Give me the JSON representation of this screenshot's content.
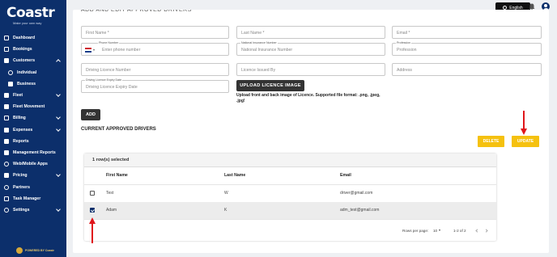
{
  "brand": {
    "name": "Coastr",
    "tagline": "Make your own way"
  },
  "sidebar": {
    "items": [
      {
        "label": "Dashboard"
      },
      {
        "label": "Bookings"
      },
      {
        "label": "Customers"
      },
      {
        "label": "Individual"
      },
      {
        "label": "Business"
      },
      {
        "label": "Fleet"
      },
      {
        "label": "Fleet Movement"
      },
      {
        "label": "Billing"
      },
      {
        "label": "Expenses"
      },
      {
        "label": "Reports"
      },
      {
        "label": "Management Reports"
      },
      {
        "label": "Web/Mobile Apps"
      },
      {
        "label": "Pricing"
      },
      {
        "label": "Partners"
      },
      {
        "label": "Task Manager"
      },
      {
        "label": "Settings"
      }
    ],
    "powered_by": "POWERED BY Coastr"
  },
  "topbar": {
    "language": "English"
  },
  "form": {
    "title": "ADD AND EDIT APPROVED DRIVERS",
    "first_name": {
      "placeholder": "First Name *"
    },
    "last_name": {
      "placeholder": "Last Name *"
    },
    "email": {
      "placeholder": "Email *"
    },
    "phone": {
      "label": "Phone Number",
      "placeholder": "Enter phone number"
    },
    "ni_number": {
      "label": "National Insurance Number",
      "placeholder": "National Insurance Number"
    },
    "profession": {
      "label": "Profession",
      "placeholder": "Profession"
    },
    "licence_number": {
      "placeholder": "Driving Licence Number"
    },
    "licence_issued": {
      "placeholder": "Licence Issued By"
    },
    "address": {
      "placeholder": "Address"
    },
    "expiry": {
      "label": "Driving Licence Expiry Date",
      "placeholder": "Driving Licence Expiry Date"
    },
    "upload_label": "UPLOAD LICENCE IMAGE",
    "upload_note": "Upload front and back image of Licence. Supported file format: .png, .jpeg, .jpg!",
    "add_label": "ADD"
  },
  "drivers": {
    "section_title": "CURRENT APPROVED DRIVERS",
    "delete_label": "DELETE",
    "update_label": "UPDATE",
    "selected_text": "1 row(s) selected",
    "columns": [
      "First Name",
      "Last Name",
      "Email"
    ],
    "rows": [
      {
        "first": "Test",
        "last": "W",
        "email": "driver@gmail.com",
        "checked": false
      },
      {
        "first": "Adam",
        "last": "K",
        "email": "adm_test@gmail.com",
        "checked": true
      }
    ],
    "rows_per_page_label": "Rows per page:",
    "rows_per_page": "10",
    "range": "1-2 of 2"
  },
  "colors": {
    "sidebar": "#0c2f6b",
    "accent": "#f5c10f",
    "annotation": "#e0161b"
  }
}
